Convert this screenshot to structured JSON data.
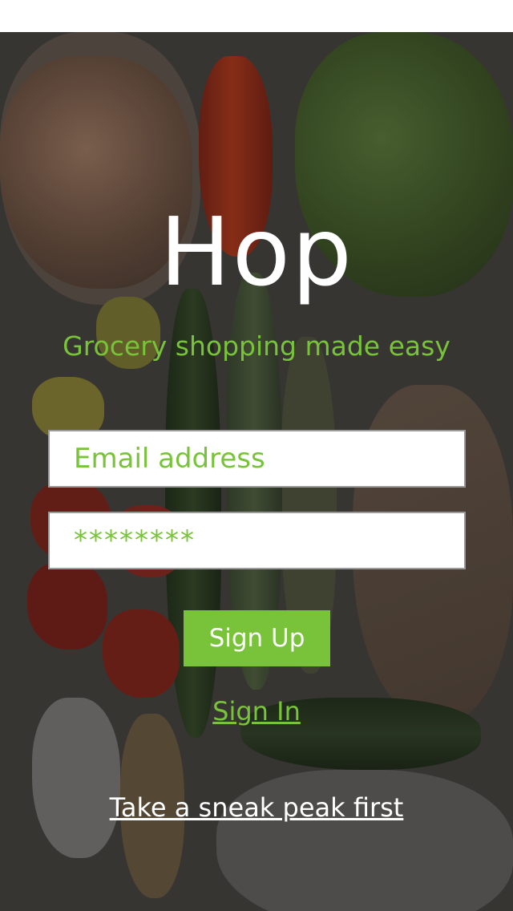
{
  "app": {
    "title": "Hop",
    "tagline": "Grocery shopping made easy"
  },
  "form": {
    "email_placeholder": "Email address",
    "email_value": "",
    "password_value": "********",
    "signup_label": "Sign Up",
    "signin_label": "Sign In",
    "peek_label": "Take a sneak peak first"
  },
  "colors": {
    "accent": "#78c33a",
    "text_light": "#ffffff"
  }
}
